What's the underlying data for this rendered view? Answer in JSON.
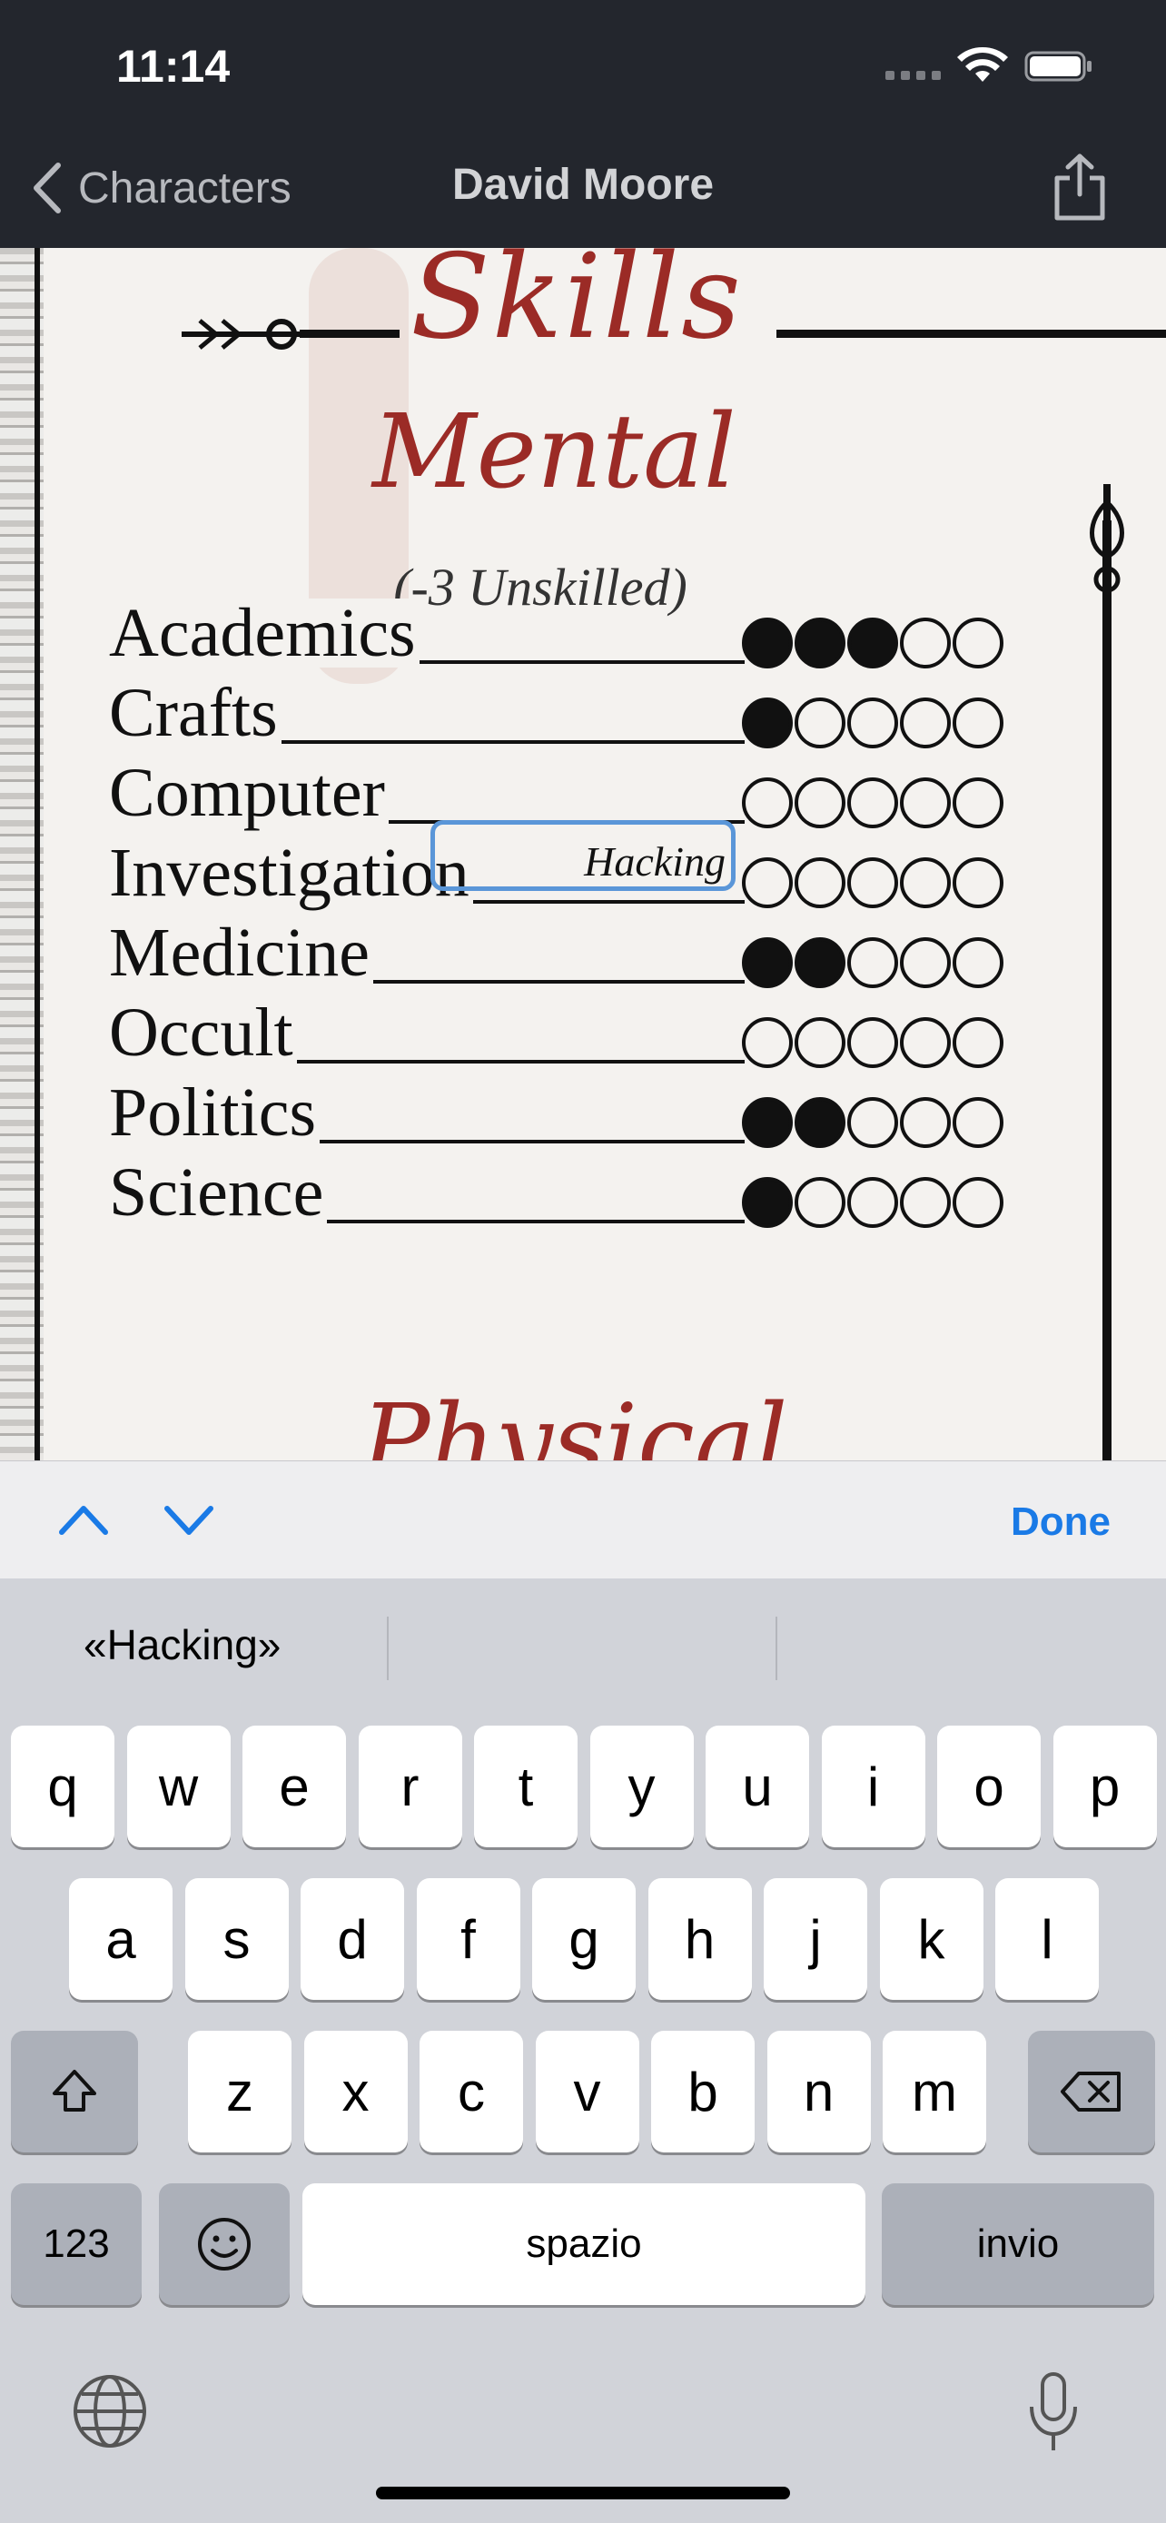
{
  "status_bar": {
    "time": "11:14"
  },
  "nav": {
    "back_label": "Characters",
    "title": "David Moore"
  },
  "sheet": {
    "section_title": "Skills",
    "category_title": "Mental",
    "unskilled_note": "(-3 Unskilled)",
    "next_category_title": "Physical",
    "skills": [
      {
        "name": "Academics",
        "rating": 3,
        "max": 5
      },
      {
        "name": "Crafts",
        "rating": 1,
        "max": 5
      },
      {
        "name": "Computer",
        "rating": 0,
        "max": 5,
        "specialty": "Hacking"
      },
      {
        "name": "Investigation",
        "rating": 0,
        "max": 5
      },
      {
        "name": "Medicine",
        "rating": 2,
        "max": 5
      },
      {
        "name": "Occult",
        "rating": 0,
        "max": 5
      },
      {
        "name": "Politics",
        "rating": 2,
        "max": 5
      },
      {
        "name": "Science",
        "rating": 1,
        "max": 5
      }
    ]
  },
  "accessory_bar": {
    "done_label": "Done"
  },
  "keyboard": {
    "suggestions": [
      "«Hacking»",
      "",
      ""
    ],
    "row1": [
      "q",
      "w",
      "e",
      "r",
      "t",
      "y",
      "u",
      "i",
      "o",
      "p"
    ],
    "row2": [
      "a",
      "s",
      "d",
      "f",
      "g",
      "h",
      "j",
      "k",
      "l"
    ],
    "row3": [
      "z",
      "x",
      "c",
      "v",
      "b",
      "n",
      "m"
    ],
    "numbers_key": "123",
    "space_key": "spazio",
    "return_key": "invio"
  },
  "colors": {
    "accent": "#1a7ae6",
    "sheet_red": "#9b2b26",
    "nav_bg": "#23262d"
  }
}
